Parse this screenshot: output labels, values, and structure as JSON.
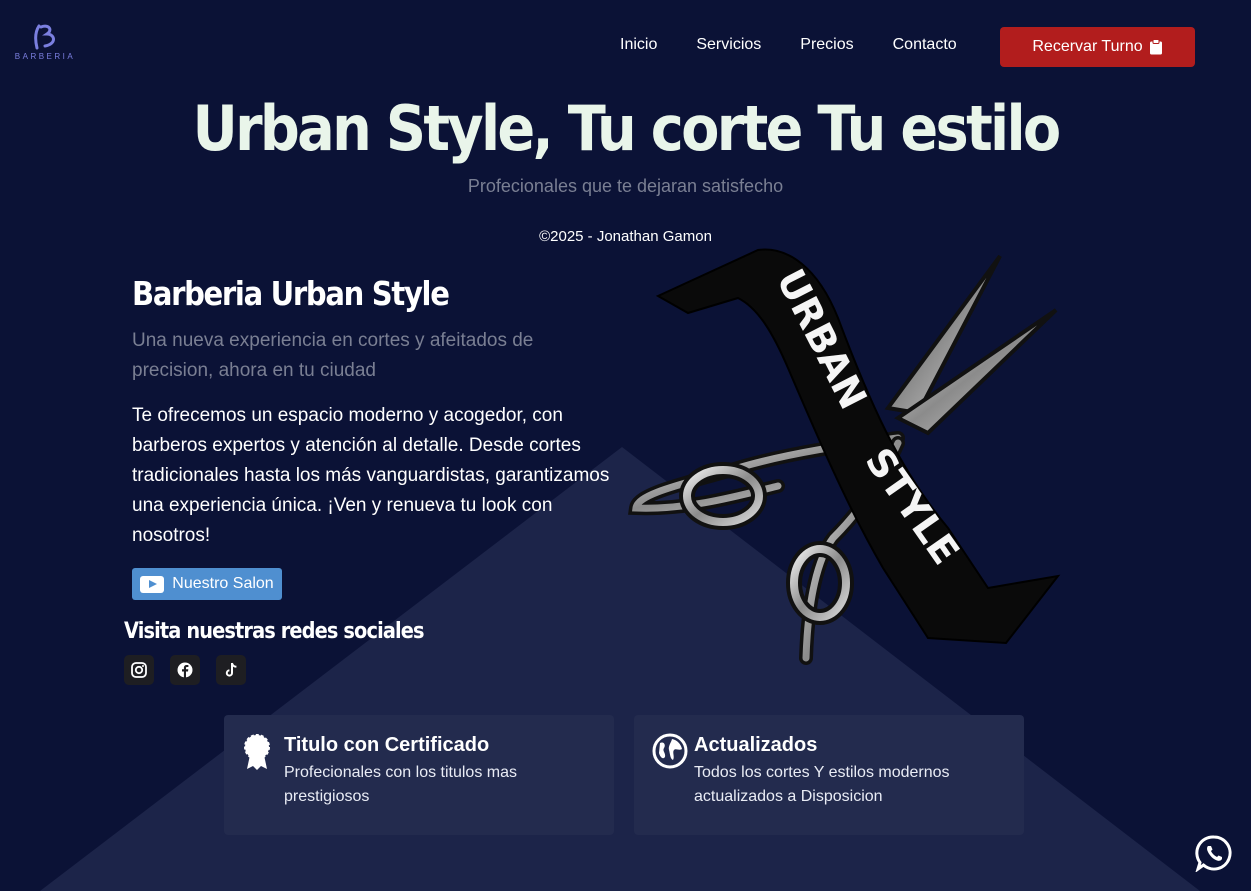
{
  "header": {
    "logo_text": "BARBERIA",
    "nav": [
      "Inicio",
      "Servicios",
      "Precios",
      "Contacto"
    ],
    "cta_label": "Recervar Turno"
  },
  "hero": {
    "title": "Urban Style, Tu corte Tu estilo",
    "subtitle": "Profecionales que te dejaran satisfecho",
    "copyright": "©2025 - Jonathan Gamon"
  },
  "about": {
    "title": "Barberia Urban Style",
    "subtitle": "Una nueva experiencia en cortes y afeitados de precision, ahora en tu ciudad",
    "description": "Te ofrecemos un espacio moderno y acogedor, con barberos expertos y atención al detalle. Desde cortes tradicionales hasta los más vanguardistas, garantizamos una experiencia única. ¡Ven y renueva tu look con nosotros!",
    "salon_button": "Nuestro Salon",
    "social_title": "Visita nuestras redes sociales",
    "socials": [
      "instagram-icon",
      "facebook-icon",
      "tiktok-icon"
    ]
  },
  "emblem": {
    "line1": "URBAN",
    "line2": "STYLE"
  },
  "features": [
    {
      "icon": "award-icon",
      "title": "Titulo con Certificado",
      "text": "Profecionales con los titulos mas prestigiosos"
    },
    {
      "icon": "globe-icon",
      "title": "Actualizados",
      "text": "Todos los cortes Y estilos modernos actualizados a Disposicion"
    }
  ],
  "colors": {
    "background": "#0b1236",
    "accent_red": "#b21d1d",
    "button_blue": "#4f8fd0",
    "card": "#232b4e"
  },
  "floating": {
    "icon": "whatsapp-icon"
  }
}
